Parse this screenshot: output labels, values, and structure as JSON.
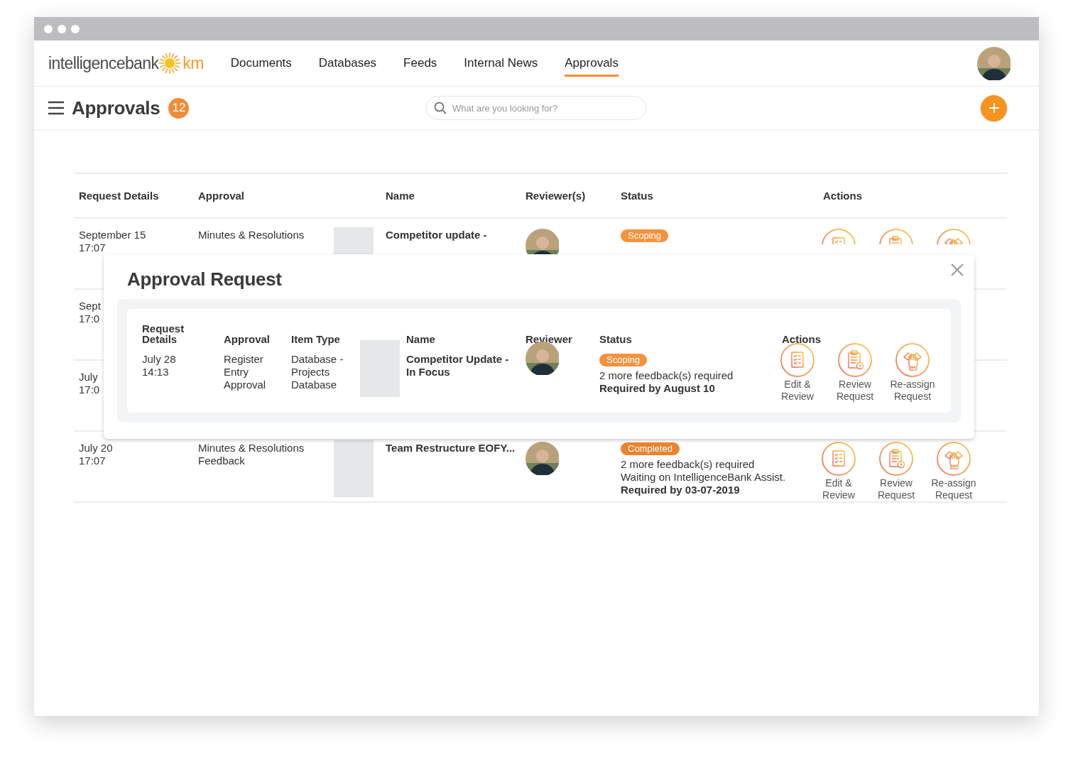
{
  "nav": {
    "logo_word": "intelligencebank",
    "logo_suffix": "km",
    "links": [
      {
        "label": "Documents",
        "selected": false
      },
      {
        "label": "Databases",
        "selected": false
      },
      {
        "label": "Feeds",
        "selected": false
      },
      {
        "label": "Internal News",
        "selected": false
      },
      {
        "label": "Approvals",
        "selected": true
      }
    ]
  },
  "header": {
    "title": "Approvals",
    "count": "12",
    "search": {
      "placeholder": "What are you looking for?"
    }
  },
  "table": {
    "columns": [
      "Request Details",
      "Approval",
      "Name",
      "Reviewer(s)",
      "Status",
      "Actions"
    ],
    "rows": [
      {
        "date": "September 15",
        "time": "17:07",
        "approval": "Minutes & Resolutions",
        "thumbnail": true,
        "name": "Competitor update -",
        "avatar": true,
        "status": {
          "label": "Scoping",
          "color": "#f5923e"
        },
        "actions": [
          {
            "kind": "edit"
          },
          {
            "kind": "review"
          },
          {
            "kind": "reassign"
          }
        ]
      },
      {
        "date": "Sept",
        "time": "17:0"
      },
      {
        "date": "July",
        "time": "17:0"
      },
      {
        "date": "July 20",
        "time": "17:07",
        "approval": "Minutes & Resolutions Feedback",
        "thumbnail": true,
        "name": "Team Restructure EOFY...",
        "avatar": true,
        "status": {
          "label": "Completed",
          "color": "#e8842f"
        },
        "details": [
          "2 more feedback(s) required",
          "Waiting on IntelligenceBank Assist."
        ],
        "required": "Required by 03-07-2019",
        "actions": [
          {
            "kind": "edit",
            "label": "Edit & Review"
          },
          {
            "kind": "review",
            "label": "Review Request"
          },
          {
            "kind": "reassign",
            "label": "Re-assign Request"
          }
        ]
      }
    ]
  },
  "modal": {
    "title": "Approval Request",
    "columns": [
      "Request Details",
      "Approval",
      "Item Type",
      "Name",
      "Reviewer",
      "Status",
      "Actions"
    ],
    "row": {
      "date": "July 28",
      "time": "14:13",
      "approval": "Register Entry Approval",
      "item_type": "Database - Projects Database",
      "thumbnail": true,
      "name": "Competitor Update - In Focus",
      "avatar": true,
      "status": {
        "label": "Scoping",
        "color": "#f5923e"
      },
      "details": [
        "2 more feedback(s) required"
      ],
      "required": "Required by August 10",
      "actions": [
        {
          "kind": "edit",
          "label": "Edit & Review"
        },
        {
          "kind": "review",
          "label": "Review Request"
        },
        {
          "kind": "reassign",
          "label": "Re-assign Request"
        }
      ]
    }
  }
}
